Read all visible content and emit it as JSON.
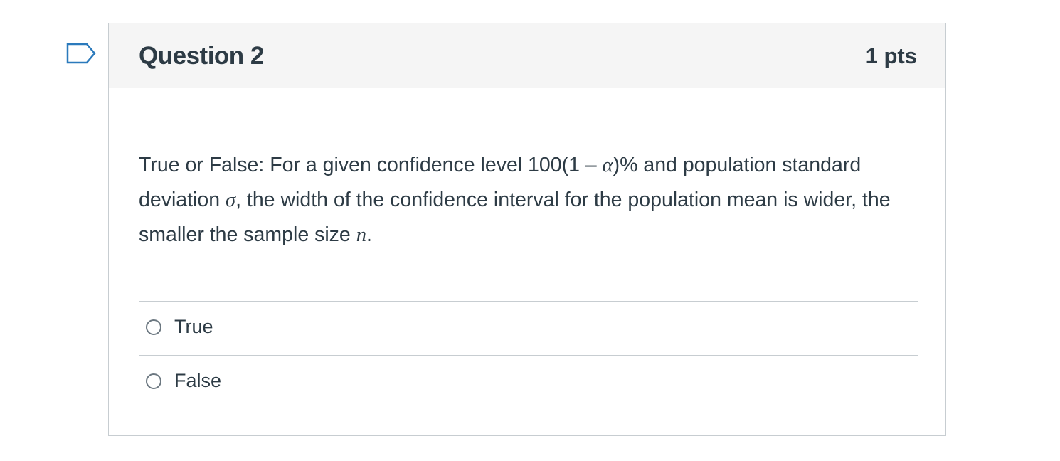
{
  "question": {
    "title": "Question 2",
    "points": "1 pts",
    "text_part1": "True or False: For a given confidence level 100(1 – ",
    "alpha": "α",
    "text_part2": ")% and population standard deviation ",
    "sigma": "σ",
    "text_part3": ", the width of the confidence interval for the population mean is wider, the smaller the sample size ",
    "n_var": "n",
    "text_part4": "."
  },
  "answers": [
    {
      "label": "True",
      "selected": false
    },
    {
      "label": "False",
      "selected": false
    }
  ],
  "flag": {
    "icon": "flag-question-icon"
  },
  "colors": {
    "text": "#2d3b45",
    "border": "#c7cdd1",
    "header_bg": "#f5f5f5",
    "flag_stroke": "#2b7abc"
  }
}
